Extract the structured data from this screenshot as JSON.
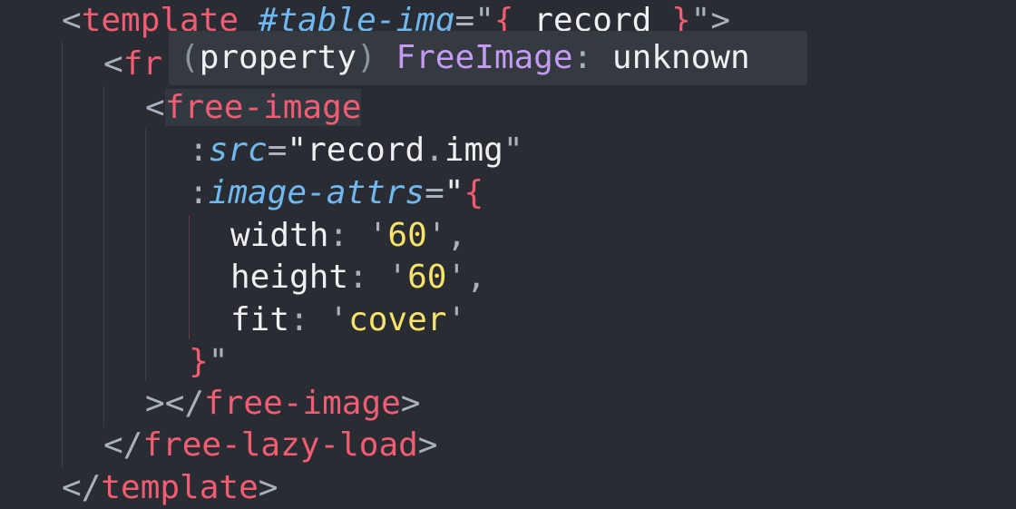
{
  "code": {
    "line1": {
      "open": "<",
      "tag": "template",
      "space": " ",
      "attr": "#table-img",
      "eq": "=",
      "q1": "\"",
      "brace_open": "{",
      "val": " record ",
      "brace_close": "}",
      "q2": "\"",
      "close": ">"
    },
    "line2": {
      "open": "<",
      "tag": "fr"
    },
    "line3": {
      "open": "<",
      "tag": "free-image"
    },
    "line4": {
      "colon": ":",
      "attr": "src",
      "eq": "=",
      "q1": "\"",
      "obj": "record",
      "dot": ".",
      "prop": "img",
      "q2": "\""
    },
    "line5": {
      "colon": ":",
      "attr": "image-attrs",
      "eq": "=",
      "q1": "\"",
      "brace": "{"
    },
    "line6": {
      "key": "width",
      "colon": ": ",
      "q1": "'",
      "val": "60",
      "q2": "'",
      "comma": ","
    },
    "line7": {
      "key": "height",
      "colon": ": ",
      "q1": "'",
      "val": "60",
      "q2": "'",
      "comma": ","
    },
    "line8": {
      "key": "fit",
      "colon": ": ",
      "q1": "'",
      "val": "cover",
      "q2": "'"
    },
    "line9": {
      "brace": "}",
      "q": "\""
    },
    "line10": {
      "gt": ">",
      "open": "</",
      "tag": "free-image",
      "close": ">"
    },
    "line11": {
      "open": "</",
      "tag": "free-lazy-load",
      "close": ">"
    },
    "line12": {
      "open": "</",
      "tag": "template",
      "close": ">"
    }
  },
  "tooltip": {
    "paren_open": "(",
    "kind": "property",
    "paren_close": ")",
    "name": "FreeImage",
    "colon": ":",
    "type": "unknown"
  },
  "colors": {
    "background": "#292d33",
    "tag": "#f25c72",
    "attribute": "#6fb8f0",
    "string_value": "#f7e36a",
    "tooltip_name": "#c39cf2"
  }
}
